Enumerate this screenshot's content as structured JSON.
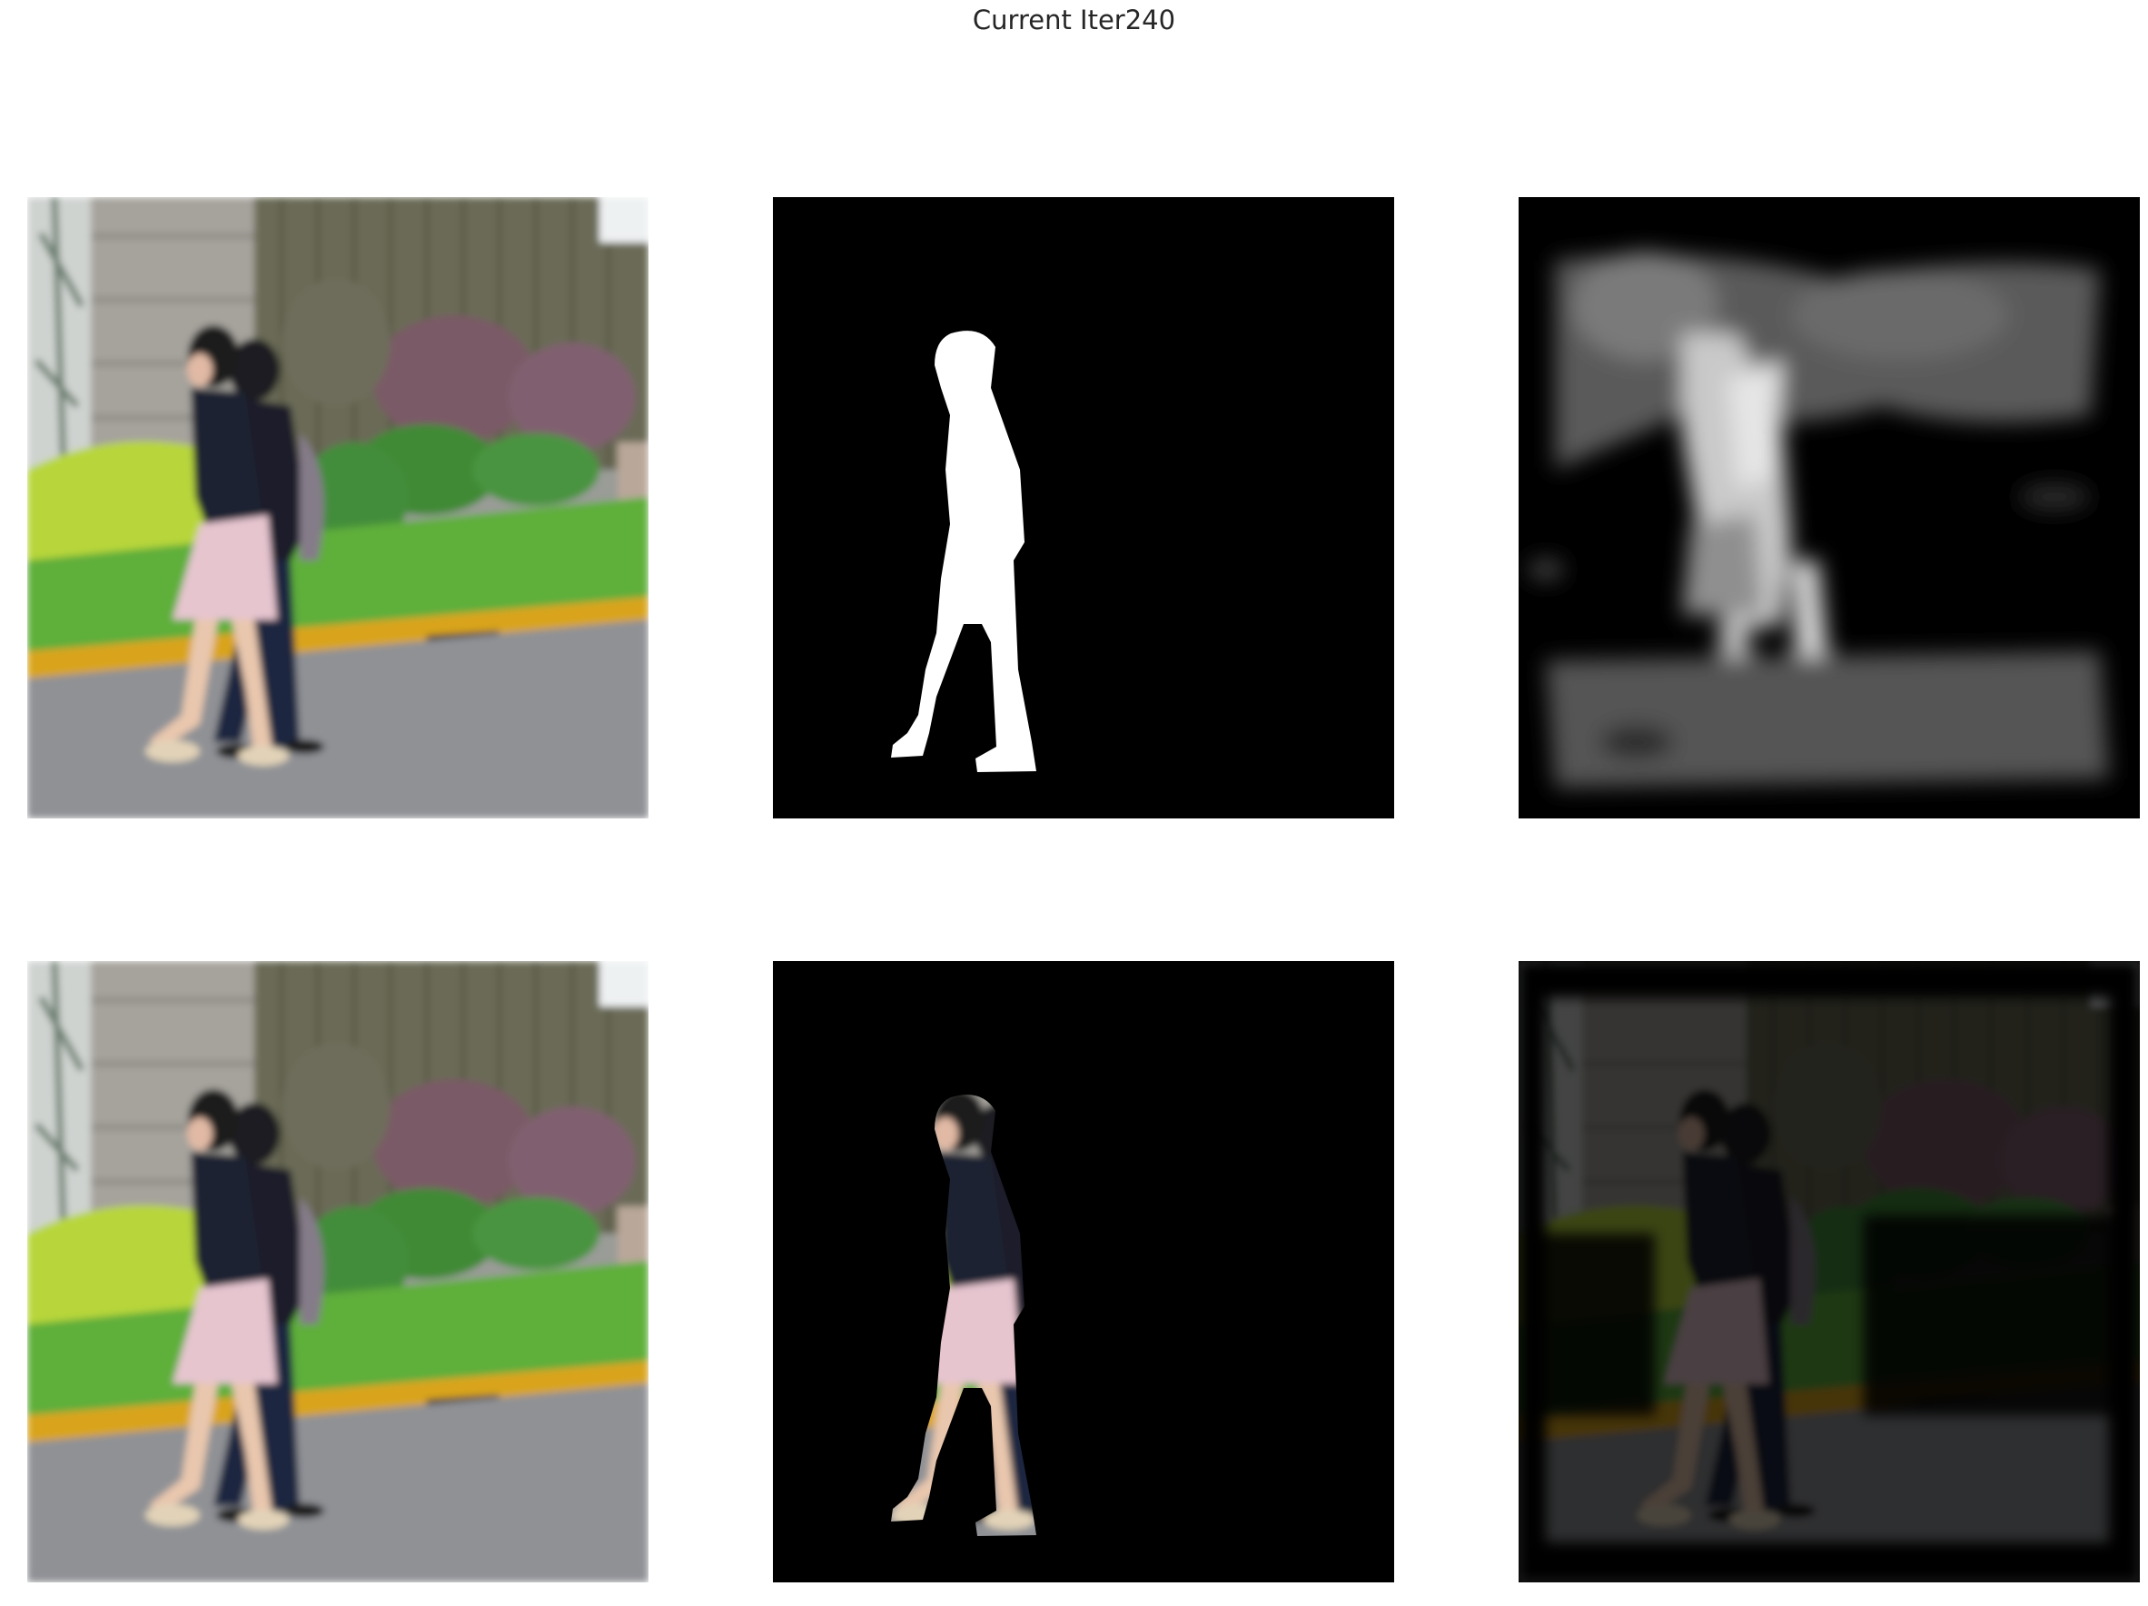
{
  "figure": {
    "title": "Current Iter240"
  },
  "panels": [
    {
      "id": "input-image",
      "kind": "photo"
    },
    {
      "id": "ground-truth-mask",
      "kind": "binary-mask"
    },
    {
      "id": "predicted-saliency-map",
      "kind": "grayscale-map"
    },
    {
      "id": "input-image-copy",
      "kind": "photo"
    },
    {
      "id": "masked-ground-truth",
      "kind": "masked-photo"
    },
    {
      "id": "masked-prediction",
      "kind": "dimmed-photo"
    }
  ],
  "colors": {
    "background": "#ffffff",
    "title_text": "#262626",
    "mask_fg": "#ffffff",
    "mask_bg": "#000000",
    "grass": "#5fae3a",
    "bush": "#b9d93a",
    "road": "#8e9094",
    "curb": "#d7a21c",
    "wall": "#a3a09a",
    "skirt": "#e7c7d0",
    "jacket": "#1c2230"
  }
}
